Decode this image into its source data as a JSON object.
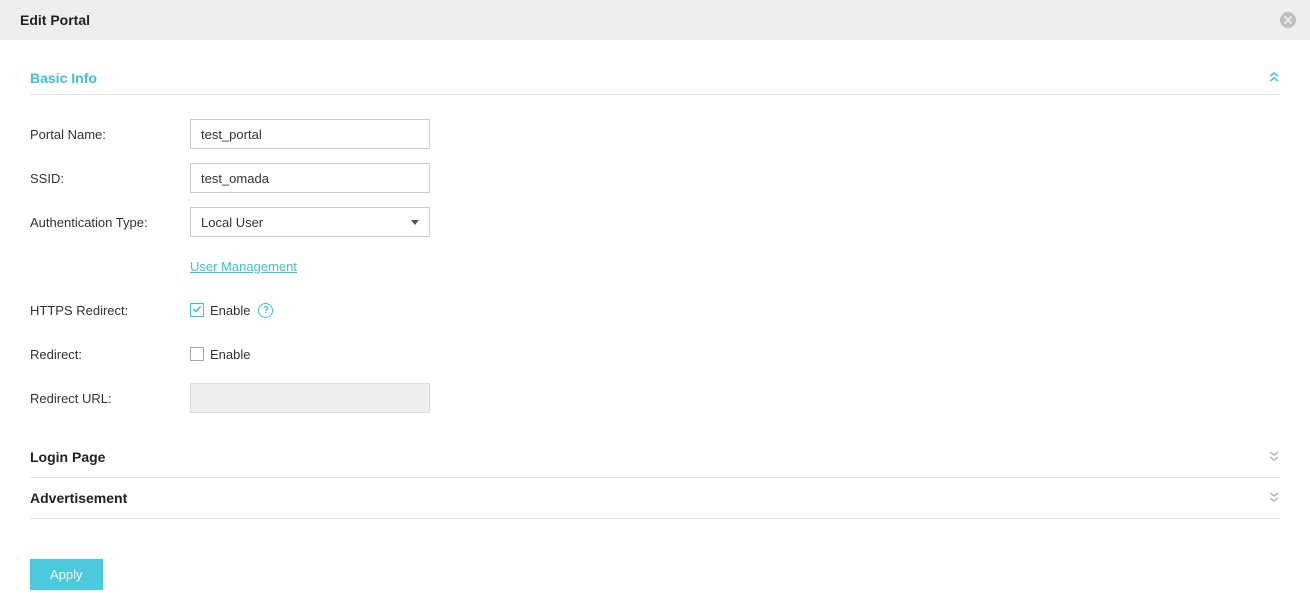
{
  "modal": {
    "title": "Edit Portal"
  },
  "sections": {
    "basic_info": {
      "title": "Basic Info"
    },
    "login_page": {
      "title": "Login Page"
    },
    "advertisement": {
      "title": "Advertisement"
    }
  },
  "form": {
    "portal_name": {
      "label": "Portal Name:",
      "value": "test_portal"
    },
    "ssid": {
      "label": "SSID:",
      "value": "test_omada"
    },
    "auth_type": {
      "label": "Authentication Type:",
      "selected": "Local User"
    },
    "user_management_link": "User Management",
    "https_redirect": {
      "label": "HTTPS Redirect:",
      "checkbox_label": "Enable",
      "checked": true
    },
    "redirect": {
      "label": "Redirect:",
      "checkbox_label": "Enable",
      "checked": false
    },
    "redirect_url": {
      "label": "Redirect URL:",
      "value": ""
    }
  },
  "actions": {
    "apply": "Apply"
  }
}
